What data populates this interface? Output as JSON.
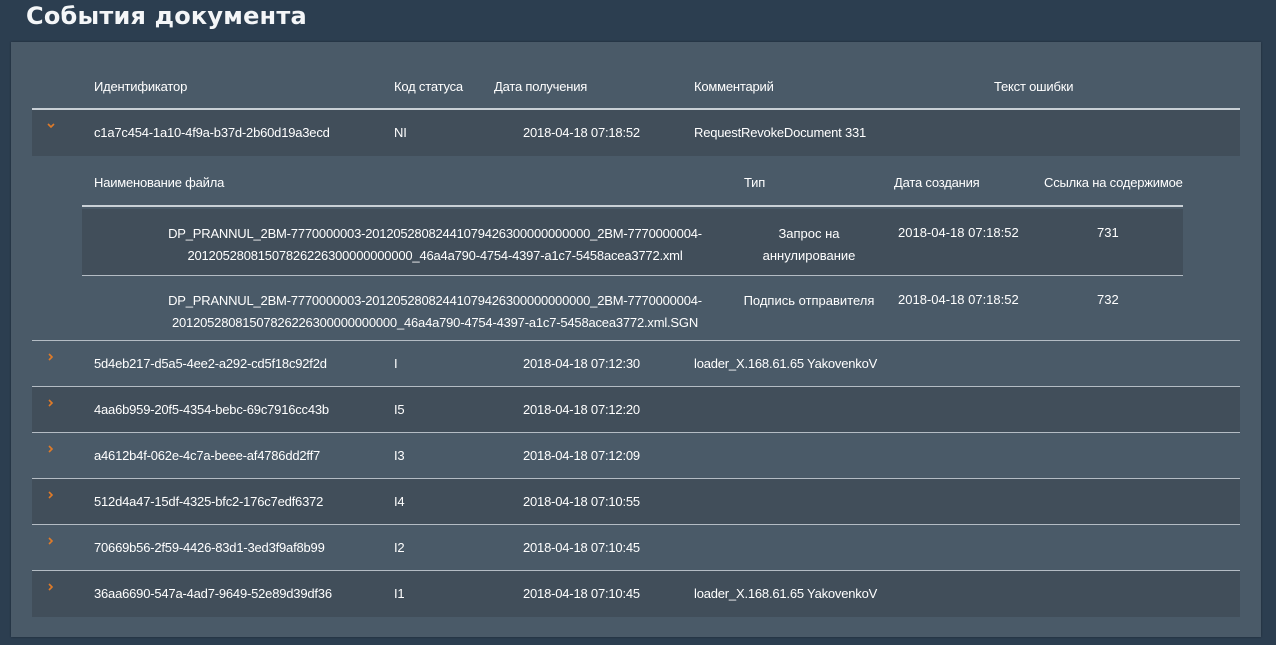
{
  "page_title": "События документа",
  "columns": {
    "id": "Идентификатор",
    "status": "Код статуса",
    "date": "Дата получения",
    "comment": "Комментарий",
    "error": "Текст ошибки"
  },
  "detail_columns": {
    "filename": "Наименование файла",
    "type": "Тип",
    "created": "Дата создания",
    "link": "Ссылка на содержимое"
  },
  "expanded_row": {
    "id": "c1a7c454-1a10-4f9a-b37d-2b60d19a3ecd",
    "status": "NI",
    "date": "2018-04-18 07:18:52",
    "comment": "RequestRevokeDocument 331",
    "error": "",
    "chevron_icon": "chevron-down-icon",
    "files": [
      {
        "name_line1": "DP_PRANNUL_2BM-7770000003-20120528082441079426300000000000_2BM-7770000004-",
        "name_line2": "20120528081507826226300000000000_46a4a790-4754-4397-a1c7-5458acea3772.xml",
        "type_line1": "Запрос на",
        "type_line2": "аннулирование",
        "created": "2018-04-18 07:18:52",
        "link": "731"
      },
      {
        "name_line1": "DP_PRANNUL_2BM-7770000003-20120528082441079426300000000000_2BM-7770000004-",
        "name_line2": "20120528081507826226300000000000_46a4a790-4754-4397-a1c7-5458acea3772.xml.SGN",
        "type_line1": "Подпись отправителя",
        "type_line2": "",
        "created": "2018-04-18 07:18:52",
        "link": "732"
      }
    ]
  },
  "rows": [
    {
      "id": "5d4eb217-d5a5-4ee2-a292-cd5f18c92f2d",
      "status": "I",
      "date": "2018-04-18 07:12:30",
      "comment": "loader_X.168.61.65 YakovenkoV",
      "error": ""
    },
    {
      "id": "4aa6b959-20f5-4354-bebc-69c7916cc43b",
      "status": "I5",
      "date": "2018-04-18 07:12:20",
      "comment": "",
      "error": ""
    },
    {
      "id": "a4612b4f-062e-4c7a-beee-af4786dd2ff7",
      "status": "I3",
      "date": "2018-04-18 07:12:09",
      "comment": "",
      "error": ""
    },
    {
      "id": "512d4a47-15df-4325-bfc2-176c7edf6372",
      "status": "I4",
      "date": "2018-04-18 07:10:55",
      "comment": "",
      "error": ""
    },
    {
      "id": "70669b56-2f59-4426-83d1-3ed3f9af8b99",
      "status": "I2",
      "date": "2018-04-18 07:10:45",
      "comment": "",
      "error": ""
    },
    {
      "id": "36aa6690-547a-4ad7-9649-52e89d39df36",
      "status": "I1",
      "date": "2018-04-18 07:10:45",
      "comment": "loader_X.168.61.65 YakovenkoV",
      "error": ""
    }
  ],
  "row_chevron_icon": "chevron-right-icon",
  "colors": {
    "background": "#2c3e50",
    "panel": "#4a5a68",
    "row_alt": "#414e5a",
    "accent_chevron": "#e07b28"
  }
}
